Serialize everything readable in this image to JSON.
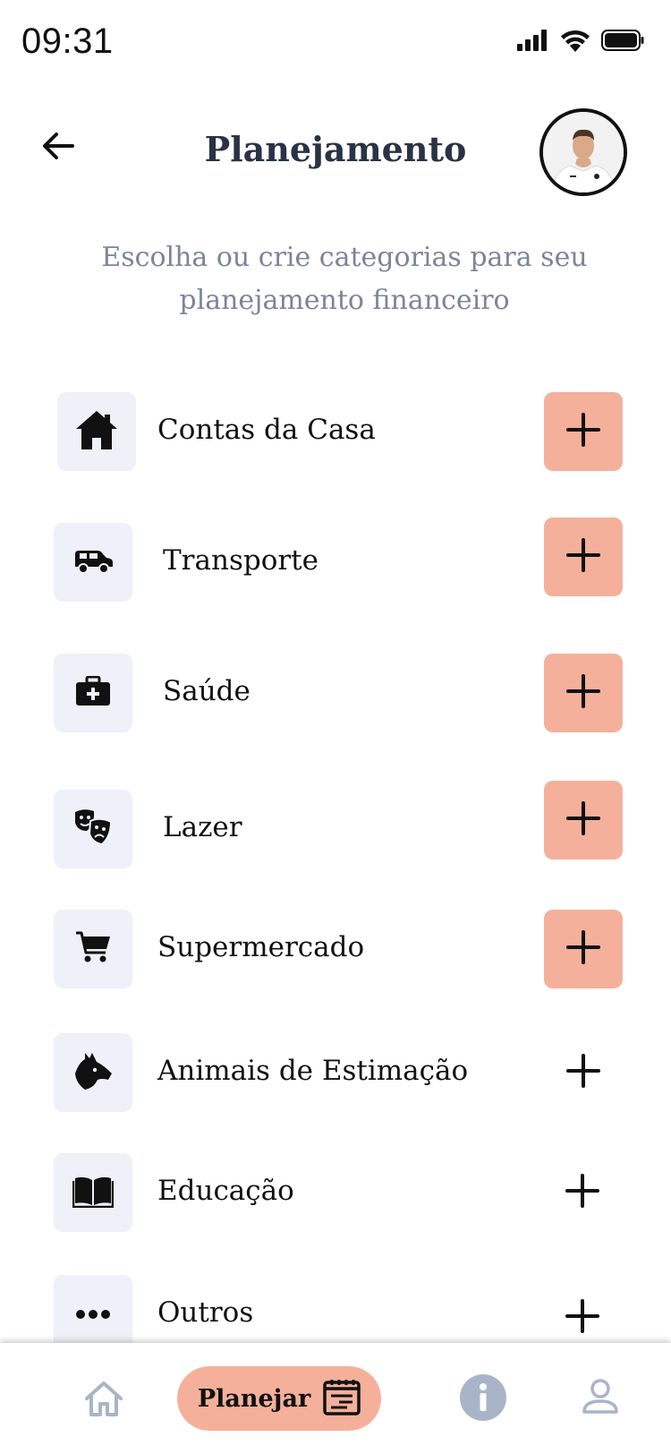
{
  "status_bar": {
    "time": "09:31",
    "icons": [
      "signal-icon",
      "wifi-icon",
      "battery-icon"
    ]
  },
  "header": {
    "title": "Planejamento",
    "back_icon": "arrow-left-icon"
  },
  "subtitle": {
    "line1": "Escolha ou crie categorias para seu",
    "line2": "planejamento financeiro"
  },
  "categories": [
    {
      "label": "Contas da Casa",
      "icon": "house-icon",
      "add_filled": true
    },
    {
      "label": "Transporte",
      "icon": "car-icon",
      "add_filled": true
    },
    {
      "label": "Saúde",
      "icon": "medical-kit-icon",
      "add_filled": true
    },
    {
      "label": "Lazer",
      "icon": "theater-masks-icon",
      "add_filled": true
    },
    {
      "label": "Supermercado",
      "icon": "shopping-cart-icon",
      "add_filled": true
    },
    {
      "label": "Animais de Estimação",
      "icon": "dog-icon",
      "add_filled": false
    },
    {
      "label": "Educação",
      "icon": "book-icon",
      "add_filled": false
    },
    {
      "label": "Outros",
      "icon": "more-dots-icon",
      "add_filled": false
    }
  ],
  "bottom_nav": {
    "items": [
      {
        "name": "home",
        "icon": "home-icon"
      },
      {
        "name": "planejar",
        "label": "Planejar",
        "icon": "planner-icon",
        "active": true
      },
      {
        "name": "info",
        "icon": "info-icon"
      },
      {
        "name": "profile",
        "icon": "user-icon"
      }
    ]
  },
  "colors": {
    "accent": "#f4b09a",
    "icon_box": "#eef1f7",
    "title": "#2a3346",
    "subtitle": "#7b8599",
    "nav_inactive": "#a9b4c9"
  }
}
